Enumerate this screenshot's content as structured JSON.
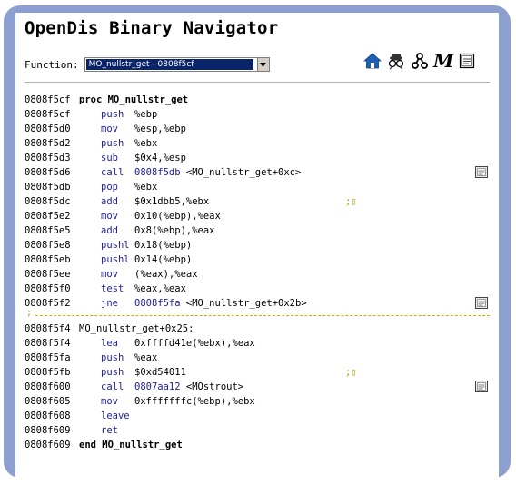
{
  "app": {
    "title": "OpenDis Binary Navigator"
  },
  "function_select": {
    "label": "Function:",
    "value": "MO_nullstr_get - 0808f5cf"
  },
  "toolbar": [
    {
      "name": "home-icon"
    },
    {
      "name": "spy-icon"
    },
    {
      "name": "graph-icon"
    },
    {
      "name": "m-icon",
      "text": "M"
    },
    {
      "name": "notes-icon"
    }
  ],
  "listing": [
    {
      "type": "proc",
      "addr": "0808f5cf",
      "text": "proc MO_nullstr_get"
    },
    {
      "type": "insn",
      "addr": "0808f5cf",
      "mn": "push",
      "ops": "%ebp"
    },
    {
      "type": "insn",
      "addr": "0808f5d0",
      "mn": "mov",
      "ops": "%esp,%ebp"
    },
    {
      "type": "insn",
      "addr": "0808f5d2",
      "mn": "push",
      "ops": "%ebx"
    },
    {
      "type": "insn",
      "addr": "0808f5d3",
      "mn": "sub",
      "ops": "$0x4,%esp"
    },
    {
      "type": "insn",
      "addr": "0808f5d6",
      "mn": "call",
      "target": "0808f5db",
      "ops": " <MO_nullstr_get+0xc>",
      "button": true
    },
    {
      "type": "insn",
      "addr": "0808f5db",
      "mn": "pop",
      "ops": "%ebx"
    },
    {
      "type": "insn",
      "addr": "0808f5dc",
      "mn": "add",
      "ops": "$0x1dbb5,%ebx",
      "comment": ";▯"
    },
    {
      "type": "insn",
      "addr": "0808f5e2",
      "mn": "mov",
      "ops": "0x10(%ebp),%eax"
    },
    {
      "type": "insn",
      "addr": "0808f5e5",
      "mn": "add",
      "ops": "0x8(%ebp),%eax"
    },
    {
      "type": "insn",
      "addr": "0808f5e8",
      "mn": "pushl",
      "ops": "0x18(%ebp)"
    },
    {
      "type": "insn",
      "addr": "0808f5eb",
      "mn": "pushl",
      "ops": "0x14(%ebp)"
    },
    {
      "type": "insn",
      "addr": "0808f5ee",
      "mn": "mov",
      "ops": "(%eax),%eax"
    },
    {
      "type": "insn",
      "addr": "0808f5f0",
      "mn": "test",
      "ops": "%eax,%eax"
    },
    {
      "type": "insn",
      "addr": "0808f5f2",
      "mn": "jne",
      "target": "0808f5fa",
      "ops": " <MO_nullstr_get+0x2b>",
      "button": true
    },
    {
      "type": "dash",
      "text": ";"
    },
    {
      "type": "label",
      "addr": "0808f5f4",
      "text": "MO_nullstr_get+0x25:"
    },
    {
      "type": "insn",
      "addr": "0808f5f4",
      "mn": "lea",
      "ops": "0xffffd41e(%ebx),%eax"
    },
    {
      "type": "insn",
      "addr": "0808f5fa",
      "mn": "push",
      "ops": "%eax"
    },
    {
      "type": "insn",
      "addr": "0808f5fb",
      "mn": "push",
      "ops": "$0xd54011",
      "comment": ";▯"
    },
    {
      "type": "insn",
      "addr": "0808f600",
      "mn": "call",
      "target": "0807aa12",
      "ops": " <MOstrout>",
      "button": true
    },
    {
      "type": "insn",
      "addr": "0808f605",
      "mn": "mov",
      "ops": "0xfffffffc(%ebp),%ebx"
    },
    {
      "type": "insn",
      "addr": "0808f608",
      "mn": "leave",
      "ops": ""
    },
    {
      "type": "insn",
      "addr": "0808f609",
      "mn": "ret",
      "ops": ""
    },
    {
      "type": "proc",
      "addr": "0808f609",
      "text": "end MO_nullstr_get"
    }
  ]
}
